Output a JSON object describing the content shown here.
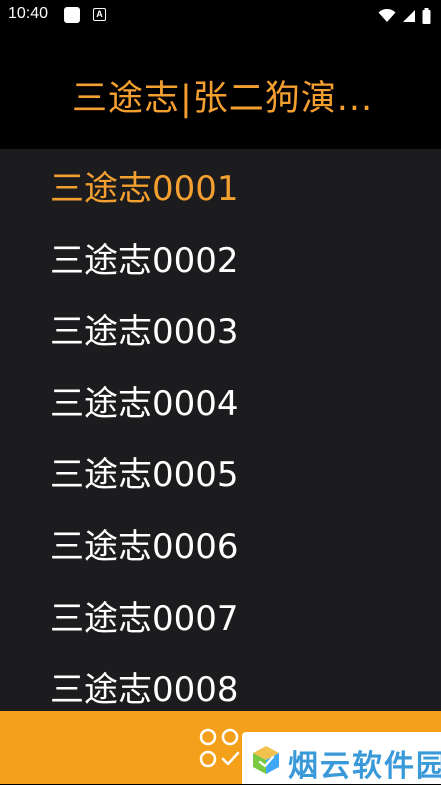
{
  "status_bar": {
    "time": "10:40",
    "notification_icon_letter": "A",
    "icons": [
      "app-square-icon",
      "text-notification-icon",
      "wifi-icon",
      "signal-icon",
      "battery-icon"
    ]
  },
  "header": {
    "title": "三途志|张二狗演..."
  },
  "episodes": [
    {
      "label": "三途志0001",
      "active": true
    },
    {
      "label": "三途志0002",
      "active": false
    },
    {
      "label": "三途志0003",
      "active": false
    },
    {
      "label": "三途志0004",
      "active": false
    },
    {
      "label": "三途志0005",
      "active": false
    },
    {
      "label": "三途志0006",
      "active": false
    },
    {
      "label": "三途志0007",
      "active": false
    },
    {
      "label": "三途志0008",
      "active": false
    }
  ],
  "bottom_bar": {
    "icon": "episode-grid-icon"
  },
  "watermark": {
    "text": "烟云软件园"
  },
  "colors": {
    "accent": "#f4a031",
    "bottom_bar": "#f5a01a",
    "list_background": "#1c1c1e",
    "header_background": "#000000",
    "item_text": "#ffffff",
    "watermark_text": "#3a9ad9"
  }
}
